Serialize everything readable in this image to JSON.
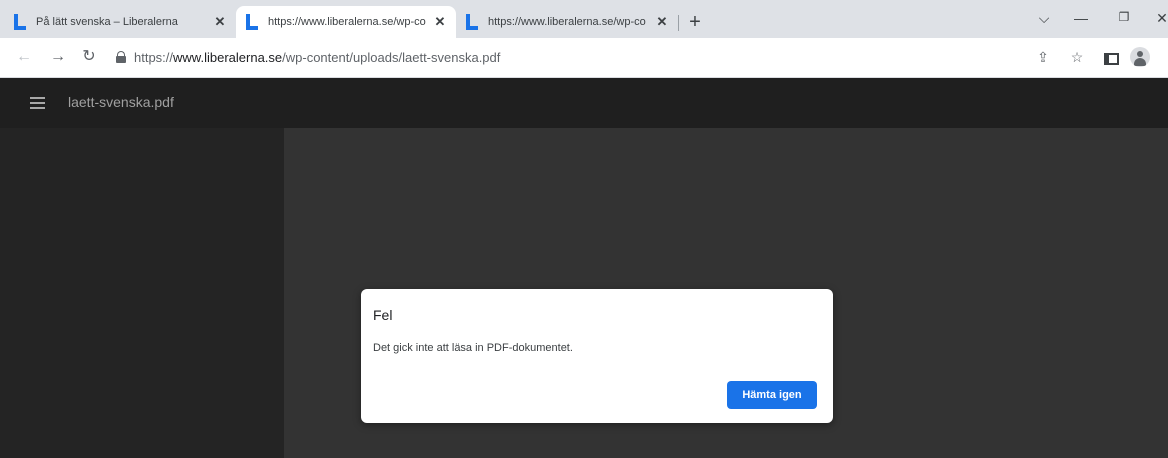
{
  "browser": {
    "tabs": [
      {
        "title": "På lätt svenska – Liberalerna",
        "active": false
      },
      {
        "title": "https://www.liberalerna.se/wp-co",
        "active": true
      },
      {
        "title": "https://www.liberalerna.se/wp-co",
        "active": false
      }
    ],
    "new_tab_symbol": "+",
    "window_controls": {
      "dropdown": "⌵",
      "minimize": "—",
      "restore": "❐",
      "close": "✕"
    },
    "url": {
      "scheme": "https://",
      "host": "www.liberalerna.se",
      "path": "/wp-content/uploads/laett-svenska.pdf"
    }
  },
  "pdf_viewer": {
    "filename": "laett-svenska.pdf"
  },
  "dialog": {
    "title": "Fel",
    "message": "Det gick inte att läsa in PDF-dokumentet.",
    "button_label": "Hämta igen"
  },
  "colors": {
    "accent": "#1a73e8",
    "viewer_toolbar": "#1f1f1f",
    "viewer_sidebar": "#242424",
    "viewer_background": "#333333"
  },
  "icons": [
    "back-icon",
    "forward-icon",
    "reload-icon",
    "lock-icon",
    "share-icon",
    "bookmark-star-icon",
    "side-panel-icon",
    "profile-icon",
    "menu-icon",
    "hamburger-icon"
  ]
}
